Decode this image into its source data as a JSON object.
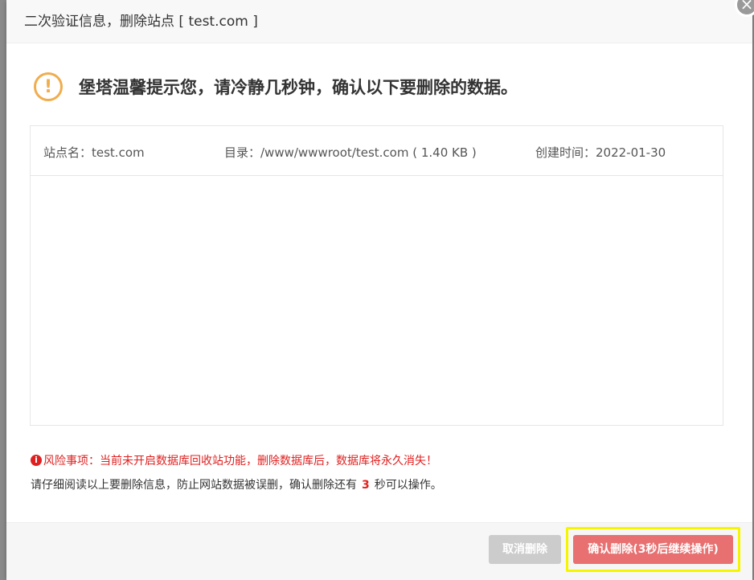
{
  "dialog": {
    "title": "二次验证信息，删除站点 [ test.com ]",
    "close_icon": "close-icon"
  },
  "notice": {
    "icon": "warning-icon",
    "text": "堡塔温馨提示您，请冷静几秒钟，确认以下要删除的数据。"
  },
  "site_info": {
    "name_label": "站点名：test.com",
    "dir_label": "目录：/www/wwwroot/test.com ( 1.40 KB )",
    "time_label": "创建时间：2022-01-30"
  },
  "risk": {
    "icon": "info-icon",
    "icon_glyph": "i",
    "text": "风险事项：当前未开启数据库回收站功能，删除数据库后，数据库将永久消失！"
  },
  "read_notice": {
    "before": "请仔细阅读以上要删除信息，防止网站数据被误删，确认删除还有",
    "count": "3",
    "after": "秒可以操作。"
  },
  "buttons": {
    "cancel_label": "取消删除",
    "confirm_label": "确认删除(3秒后继续操作)"
  },
  "colors": {
    "danger": "#e02020",
    "warning": "#f0ad4e",
    "confirm_button": "#e87070",
    "cancel_button": "#cccccc",
    "highlight": "#f5f500"
  }
}
